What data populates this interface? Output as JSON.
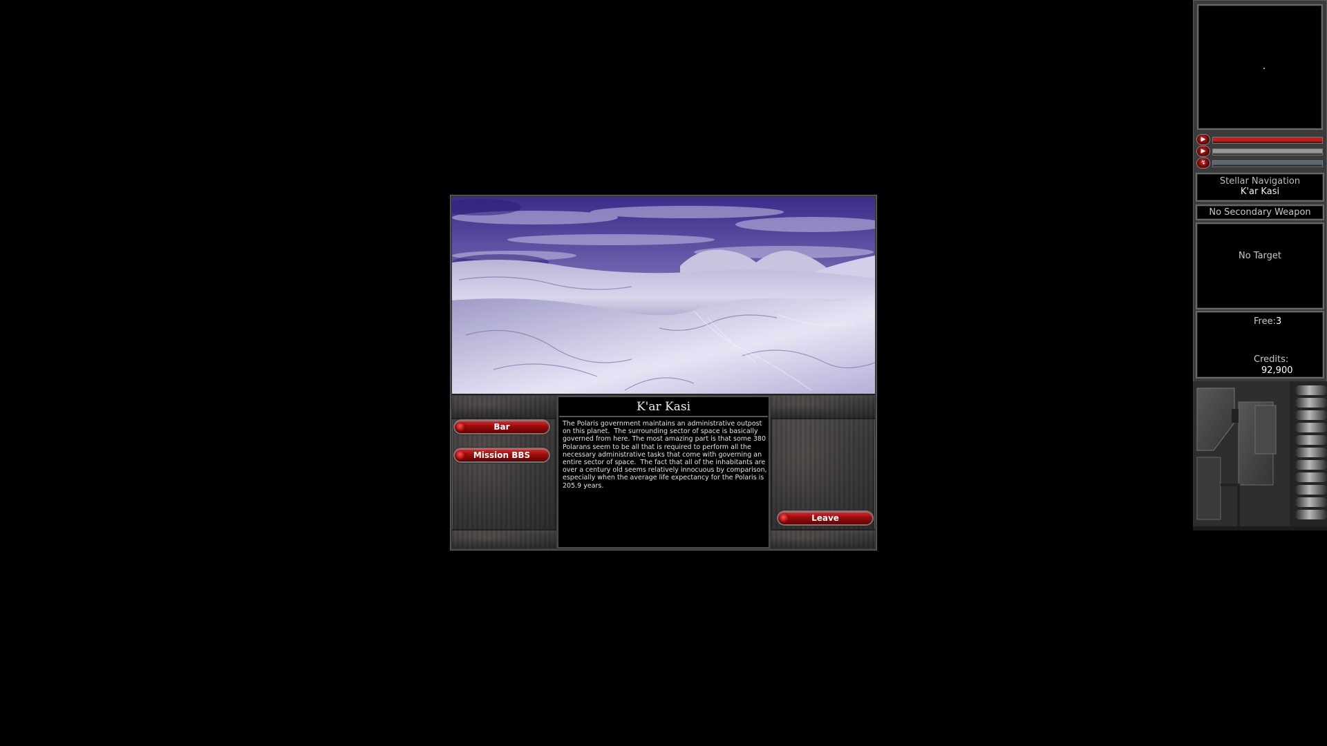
{
  "planet": {
    "name": "K'ar Kasi",
    "description": "The Polaris government maintains an administrative outpost on this planet.  The surrounding sector of space is basically governed from here. The most amazing part is that some 380 Polarans seem to be all that is required to perform all the necessary administrative tasks that come with governing an entire sector of space.  The fact that all of the inhabitants are over a century old seems relatively innocuous by comparison, especially when the average life expectancy for the Polaris is 205.9 years."
  },
  "buttons": {
    "bar": "Bar",
    "mission_bbs": "Mission BBS",
    "leave": "Leave"
  },
  "hud": {
    "bars": [
      {
        "name": "hull",
        "level": 1.0,
        "color": "#d01818"
      },
      {
        "name": "shield",
        "level": 1.0,
        "color": "#9a9a9a"
      },
      {
        "name": "energy",
        "level": 1.0,
        "color": "#5a6670"
      }
    ],
    "navigation": {
      "title": "Stellar Navigation",
      "destination": "K'ar Kasi"
    },
    "secondary_weapon": "No Secondary Weapon",
    "target": "No Target",
    "cargo": {
      "free_label": "Free:",
      "free_value": "3",
      "credits_label": "Credits:",
      "credits_value": "92,900"
    }
  }
}
